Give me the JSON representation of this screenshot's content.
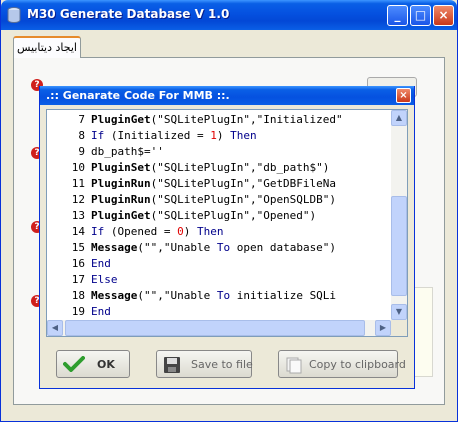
{
  "window": {
    "title": "M30 Generate Database V 1.0",
    "minimize": "_",
    "maximize": "□",
    "close": "×"
  },
  "tab": {
    "label": "ایجاد دیتابیس"
  },
  "dialog": {
    "title": ".:: Genarate Code For MMB ::.",
    "close": "×",
    "code_lines": [
      {
        "n": "7",
        "tokens": [
          {
            "t": "PluginGet",
            "c": "kw"
          },
          {
            "t": "(\"SQLitePlugIn\",\"Initialized\"",
            "c": "str"
          }
        ]
      },
      {
        "n": "8",
        "tokens": [
          {
            "t": "If",
            "c": "blue"
          },
          {
            "t": " (Initialized = ",
            "c": "str"
          },
          {
            "t": "1",
            "c": "num"
          },
          {
            "t": ") ",
            "c": "str"
          },
          {
            "t": "Then",
            "c": "blue"
          }
        ]
      },
      {
        "n": "9",
        "tokens": [
          {
            "t": "db_path$=''",
            "c": "str"
          }
        ]
      },
      {
        "n": "10",
        "tokens": [
          {
            "t": "PluginSet",
            "c": "kw"
          },
          {
            "t": "(\"SQLitePlugIn\",\"db_path$\")",
            "c": "str"
          }
        ]
      },
      {
        "n": "11",
        "tokens": [
          {
            "t": "PluginRun",
            "c": "kw"
          },
          {
            "t": "(\"SQLitePlugIn\",\"GetDBFileNa",
            "c": "str"
          }
        ]
      },
      {
        "n": "12",
        "tokens": [
          {
            "t": "PluginRun",
            "c": "kw"
          },
          {
            "t": "(\"SQLitePlugIn\",\"OpenSQLDB\")",
            "c": "str"
          }
        ]
      },
      {
        "n": "13",
        "tokens": [
          {
            "t": "PluginGet",
            "c": "kw"
          },
          {
            "t": "(\"SQLitePlugIn\",\"Opened\")",
            "c": "str"
          }
        ]
      },
      {
        "n": "14",
        "tokens": [
          {
            "t": "If",
            "c": "blue"
          },
          {
            "t": " (Opened = ",
            "c": "str"
          },
          {
            "t": "0",
            "c": "num"
          },
          {
            "t": ") ",
            "c": "str"
          },
          {
            "t": "Then",
            "c": "blue"
          }
        ]
      },
      {
        "n": "15",
        "tokens": [
          {
            "t": "Message",
            "c": "kw"
          },
          {
            "t": "(\"\",\"Unable ",
            "c": "str"
          },
          {
            "t": "To",
            "c": "blue"
          },
          {
            "t": " open database\")",
            "c": "str"
          }
        ]
      },
      {
        "n": "16",
        "tokens": [
          {
            "t": "End",
            "c": "blue"
          }
        ]
      },
      {
        "n": "17",
        "tokens": [
          {
            "t": "Else",
            "c": "blue"
          }
        ]
      },
      {
        "n": "18",
        "tokens": [
          {
            "t": "Message",
            "c": "kw"
          },
          {
            "t": "(\"\",\"Unable ",
            "c": "str"
          },
          {
            "t": "To",
            "c": "blue"
          },
          {
            "t": " initialize SQLi",
            "c": "str"
          }
        ]
      },
      {
        "n": "19",
        "tokens": [
          {
            "t": "End",
            "c": "blue"
          }
        ]
      }
    ],
    "buttons": {
      "ok": "OK",
      "save": "Save to file",
      "copy": "Copy to clipboard"
    }
  },
  "colors": {
    "titlebar": "#0551e0",
    "keyword_blue": "#00008b",
    "number_red": "#e00000",
    "ok_check": "#2e9d2e"
  },
  "icons": [
    "app-icon",
    "minimize-icon",
    "maximize-icon",
    "close-icon",
    "error-question-icon",
    "checkmark-icon",
    "floppy-disk-icon",
    "clipboard-icon",
    "scroll-up-icon",
    "scroll-down-icon",
    "scroll-left-icon",
    "scroll-right-icon"
  ]
}
